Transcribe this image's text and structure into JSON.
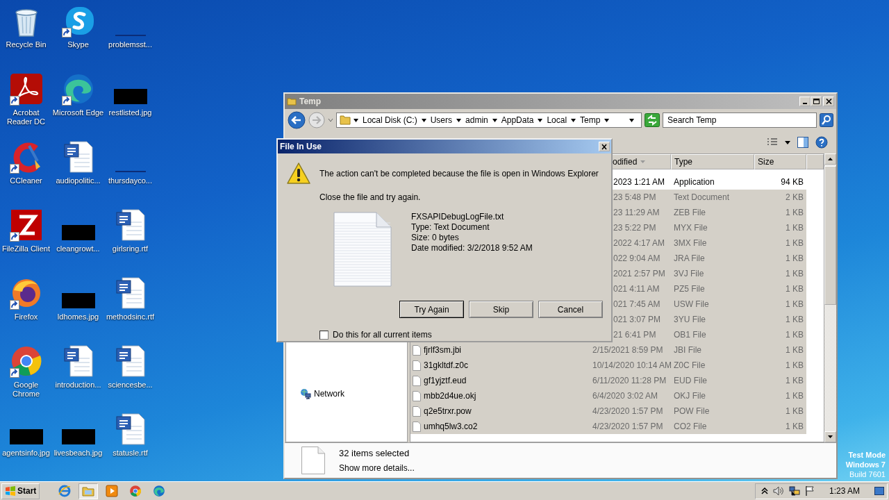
{
  "desktop": {
    "icons": [
      {
        "label": "Recycle Bin",
        "kind": "recycle",
        "shortcut": false
      },
      {
        "label": "Skype",
        "kind": "skype",
        "shortcut": true
      },
      {
        "label": "problemsst...",
        "kind": "blank",
        "shortcut": false
      },
      {
        "label": "Acrobat Reader DC",
        "kind": "acrobat",
        "shortcut": true
      },
      {
        "label": "Microsoft Edge",
        "kind": "edge",
        "shortcut": true
      },
      {
        "label": "restlisted.jpg",
        "kind": "image",
        "shortcut": false
      },
      {
        "label": "CCleaner",
        "kind": "ccleaner",
        "shortcut": true
      },
      {
        "label": "audiopolitic...",
        "kind": "word",
        "shortcut": false
      },
      {
        "label": "thursdayco...",
        "kind": "blank",
        "shortcut": false
      },
      {
        "label": "FileZilla Client",
        "kind": "filezilla",
        "shortcut": true
      },
      {
        "label": "cleangrowt...",
        "kind": "image",
        "shortcut": false
      },
      {
        "label": "girlsring.rtf",
        "kind": "word",
        "shortcut": false
      },
      {
        "label": "Firefox",
        "kind": "firefox",
        "shortcut": true
      },
      {
        "label": "ldhomes.jpg",
        "kind": "image",
        "shortcut": false
      },
      {
        "label": "methodsinc.rtf",
        "kind": "word",
        "shortcut": false
      },
      {
        "label": "Google Chrome",
        "kind": "chrome",
        "shortcut": true
      },
      {
        "label": "introduction...",
        "kind": "word",
        "shortcut": false
      },
      {
        "label": "sciencesbe...",
        "kind": "word",
        "shortcut": false
      },
      {
        "label": "agentsinfo.jpg",
        "kind": "image",
        "shortcut": false
      },
      {
        "label": "livesbeach.jpg",
        "kind": "image",
        "shortcut": false
      },
      {
        "label": "statusle.rtf",
        "kind": "word",
        "shortcut": false
      }
    ],
    "os_notice": [
      {
        "text": "Test Mode",
        "bold": true
      },
      {
        "text": "Windows 7",
        "bold": true
      },
      {
        "text": "Build 7601",
        "bold": false
      }
    ]
  },
  "explorer": {
    "title": "Temp",
    "breadcrumb": [
      "Local Disk (C:)",
      "Users",
      "admin",
      "AppData",
      "Local",
      "Temp"
    ],
    "search": {
      "placeholder": "Search Temp"
    },
    "nav_items": [
      {
        "label": "Network"
      }
    ],
    "columns": [
      "odified",
      "Type",
      "Size"
    ],
    "files": [
      {
        "date": "2023 1:21 AM",
        "type": "Application",
        "size": "94 KB",
        "selected": false
      },
      {
        "date": "23 5:48 PM",
        "type": "Text Document",
        "size": "2 KB",
        "selected": true
      },
      {
        "date": "23 11:29 AM",
        "type": "ZEB File",
        "size": "1 KB",
        "selected": true
      },
      {
        "date": "23 5:22 PM",
        "type": "MYX File",
        "size": "1 KB",
        "selected": true
      },
      {
        "date": "2022 4:17 AM",
        "type": "3MX File",
        "size": "1 KB",
        "selected": true
      },
      {
        "date": "022 9:04 AM",
        "type": "JRA File",
        "size": "1 KB",
        "selected": true
      },
      {
        "date": "2021 2:57 PM",
        "type": "3VJ File",
        "size": "1 KB",
        "selected": true
      },
      {
        "date": "021 4:11 AM",
        "type": "PZ5 File",
        "size": "1 KB",
        "selected": true
      },
      {
        "date": "021 7:45 AM",
        "type": "USW File",
        "size": "1 KB",
        "selected": true
      },
      {
        "date": "021 3:07 PM",
        "type": "3YU File",
        "size": "1 KB",
        "selected": true
      },
      {
        "date": "21 6:41 PM",
        "type": "OB1 File",
        "size": "1 KB",
        "selected": true
      },
      {
        "name": "fjrlf3sm.jbi",
        "date": "2/15/2021 8:59 PM",
        "type": "JBI File",
        "size": "1 KB",
        "selected": true
      },
      {
        "name": "31gkltdf.z0c",
        "date": "10/14/2020 10:14 AM",
        "type": "Z0C File",
        "size": "1 KB",
        "selected": true
      },
      {
        "name": "gf1yjztf.eud",
        "date": "6/11/2020 11:28 PM",
        "type": "EUD File",
        "size": "1 KB",
        "selected": true
      },
      {
        "name": "mbb2d4ue.okj",
        "date": "6/4/2020 3:02 AM",
        "type": "OKJ File",
        "size": "1 KB",
        "selected": true
      },
      {
        "name": "q2e5trxr.pow",
        "date": "4/23/2020 1:57 PM",
        "type": "POW File",
        "size": "1 KB",
        "selected": true
      },
      {
        "name": "umhq5lw3.co2",
        "date": "4/23/2020 1:57 PM",
        "type": "CO2 File",
        "size": "1 KB",
        "selected": true
      }
    ],
    "details": {
      "summary": "32 items selected",
      "link": "Show more details..."
    }
  },
  "dialog": {
    "title": "File In Use",
    "message": "The action can't be completed because the file is open in Windows Explorer",
    "hint": "Close the file and try again.",
    "file_lines": [
      "FXSAPIDebugLogFile.txt",
      "Type: Text Document",
      "Size: 0 bytes",
      "Date modified: 3/2/2018 9:52 AM"
    ],
    "buttons": [
      {
        "label": "Try Again",
        "default": true
      },
      {
        "label": "Skip",
        "default": false
      },
      {
        "label": "Cancel",
        "default": false
      }
    ],
    "checkbox": {
      "label": "Do this for all current items",
      "checked": false
    }
  },
  "taskbar": {
    "start": "Start",
    "apps": [
      {
        "kind": "ie",
        "active": false
      },
      {
        "kind": "explorer",
        "active": true
      },
      {
        "kind": "media",
        "active": false
      },
      {
        "kind": "chrome",
        "active": false
      },
      {
        "kind": "edge",
        "active": false
      }
    ],
    "clock": "1:23 AM"
  }
}
